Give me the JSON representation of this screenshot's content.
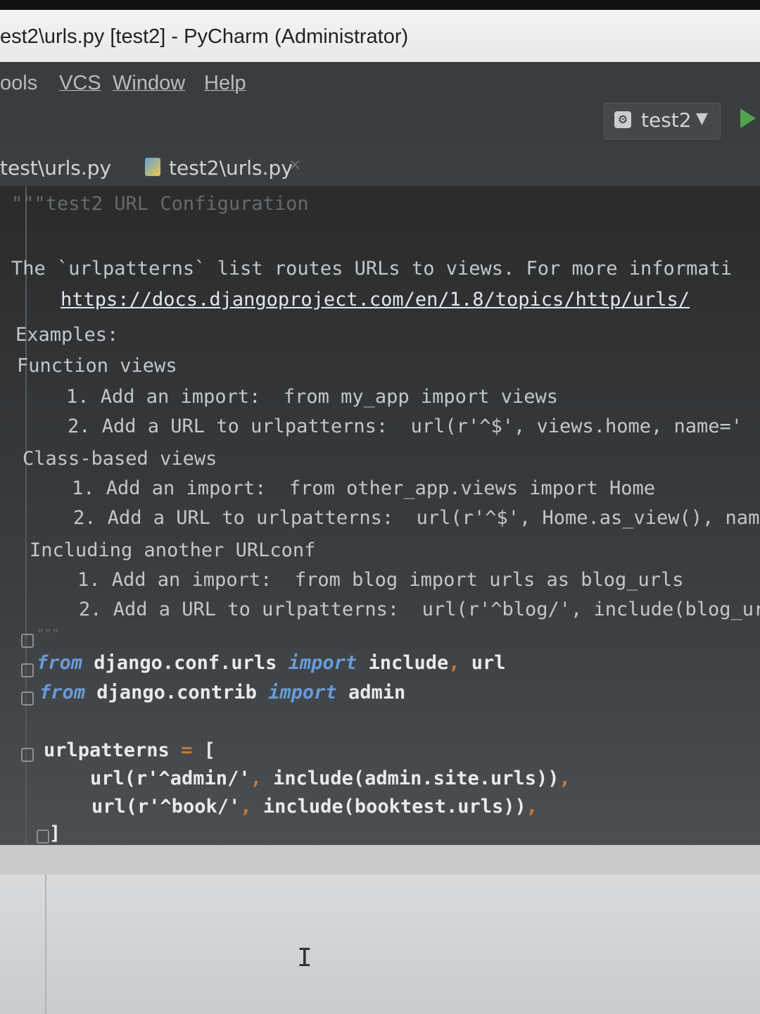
{
  "window": {
    "title": "est2\\urls.py [test2] - PyCharm (Administrator)"
  },
  "menu": {
    "items": [
      "ools",
      "VCS",
      "Window",
      "Help"
    ]
  },
  "toolbar": {
    "run_config": "test2",
    "run_config_icon": "python-icon",
    "run_icon": "run-icon"
  },
  "tabs": [
    {
      "label": "test\\urls.py",
      "active": false
    },
    {
      "label": "test2\\urls.py",
      "active": true,
      "close": "×"
    }
  ],
  "editor": {
    "lines": {
      "l1": "\"\"\"test2 URL Configuration",
      "l2": "The `urlpatterns` list routes URLs to views. For more informati",
      "l3": "https://docs.djangoproject.com/en/1.8/topics/http/urls/",
      "l4": "Examples:",
      "l5": "Function views",
      "l6": "1. Add an import:  from my_app import views",
      "l7": "2. Add a URL to urlpatterns:  url(r'^$', views.home, name='",
      "l8": "Class-based views",
      "l9": "1. Add an import:  from other_app.views import Home",
      "l10": "2. Add a URL to urlpatterns:  url(r'^$', Home.as_view(), nam",
      "l11": "Including another URLconf",
      "l12": "1. Add an import:  from blog import urls as blog_urls",
      "l13": "2. Add a URL to urlpatterns:  url(r'^blog/', include(blog_ur",
      "l14": "\"\"\""
    },
    "imports": {
      "line1": {
        "kw_from": "from",
        "module": "django.conf.urls",
        "kw_import": "import",
        "names": "include",
        "comma": ",",
        "name2": "url"
      },
      "line2": {
        "kw_from": "from",
        "module": "django.contrib",
        "kw_import": "import",
        "names": "admin"
      }
    },
    "urlpatterns": {
      "head": "urlpatterns",
      "eq": "=",
      "open": "[",
      "row1_a": "url(r'^admin/'",
      "row1_b": "include(admin.site.urls))",
      "row2_a": "url(r'^book/'",
      "row2_b": "include(booktest.urls))",
      "comma": ",",
      "close": "]"
    }
  }
}
